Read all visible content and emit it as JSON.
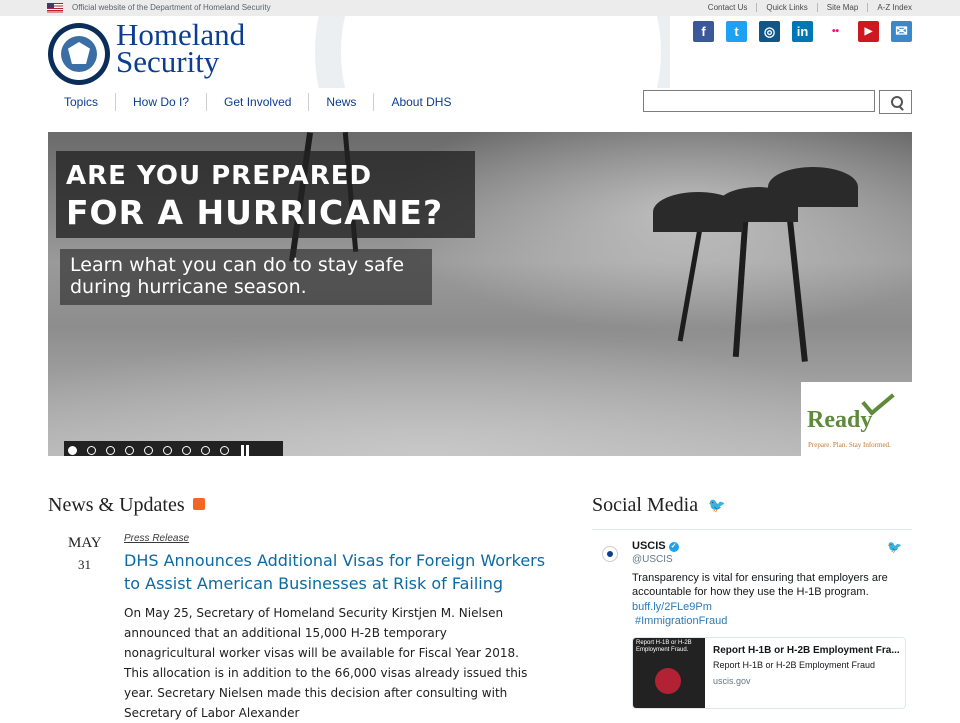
{
  "utility_bar": {
    "official": "Official website of the Department of Homeland Security",
    "links": [
      "Contact Us",
      "Quick Links",
      "Site Map",
      "A-Z Index"
    ]
  },
  "header": {
    "brand_line1": "Homeland",
    "brand_line2": "Security"
  },
  "social_icons": [
    {
      "name": "facebook-icon",
      "glyph": "f",
      "color": "#3b5998"
    },
    {
      "name": "twitter-icon",
      "glyph": "t",
      "color": "#1da1f2"
    },
    {
      "name": "instagram-icon",
      "glyph": "◎",
      "color": "#125688"
    },
    {
      "name": "linkedin-icon",
      "glyph": "in",
      "color": "#0077b5"
    },
    {
      "name": "flickr-icon",
      "glyph": "••",
      "color": "#ffffff"
    },
    {
      "name": "youtube-icon",
      "glyph": "▶",
      "color": "#cc181e"
    },
    {
      "name": "email-icon",
      "glyph": "✉",
      "color": "#3a87c9"
    }
  ],
  "nav": {
    "items": [
      "Topics",
      "How Do I?",
      "Get Involved",
      "News",
      "About DHS"
    ]
  },
  "search": {
    "value": "",
    "placeholder": ""
  },
  "hero": {
    "title_line1": "ARE YOU PREPARED",
    "title_line2": "FOR A HURRICANE?",
    "subtitle": "Learn what you can do to stay safe during hurricane season.",
    "ready_word": "Ready",
    "ready_tagline": "Prepare. Plan. Stay Informed.",
    "slides_total": 9,
    "active_slide": 1
  },
  "news": {
    "heading": "News & Updates",
    "month": "MAY",
    "day": "31",
    "category": "Press Release",
    "title": "DHS Announces Additional Visas for Foreign Workers to Assist American Businesses at Risk of Failing",
    "body": "On May 25, Secretary of Homeland Security Kirstjen M. Nielsen announced that an additional 15,000 H-2B temporary nonagricultural worker visas will be available for Fiscal Year 2018. This allocation is in addition to the 66,000 visas already issued this year. Secretary Nielsen made this decision after consulting with Secretary of Labor Alexander"
  },
  "social": {
    "heading": "Social Media",
    "tweet": {
      "name": "USCIS",
      "handle": "@USCIS",
      "text": "Transparency is vital for ensuring that employers are accountable for how they use the H-1B program.",
      "link": "buff.ly/2FLe9Pm",
      "hashtag": "#ImmigrationFraud",
      "card_image_text": "Report H-1B or H-2B Employment Fraud.",
      "card_title": "Report H-1B or H-2B Employment Fra...",
      "card_description": "Report H-1B or H-2B Employment Fraud",
      "card_url": "uscis.gov"
    }
  }
}
